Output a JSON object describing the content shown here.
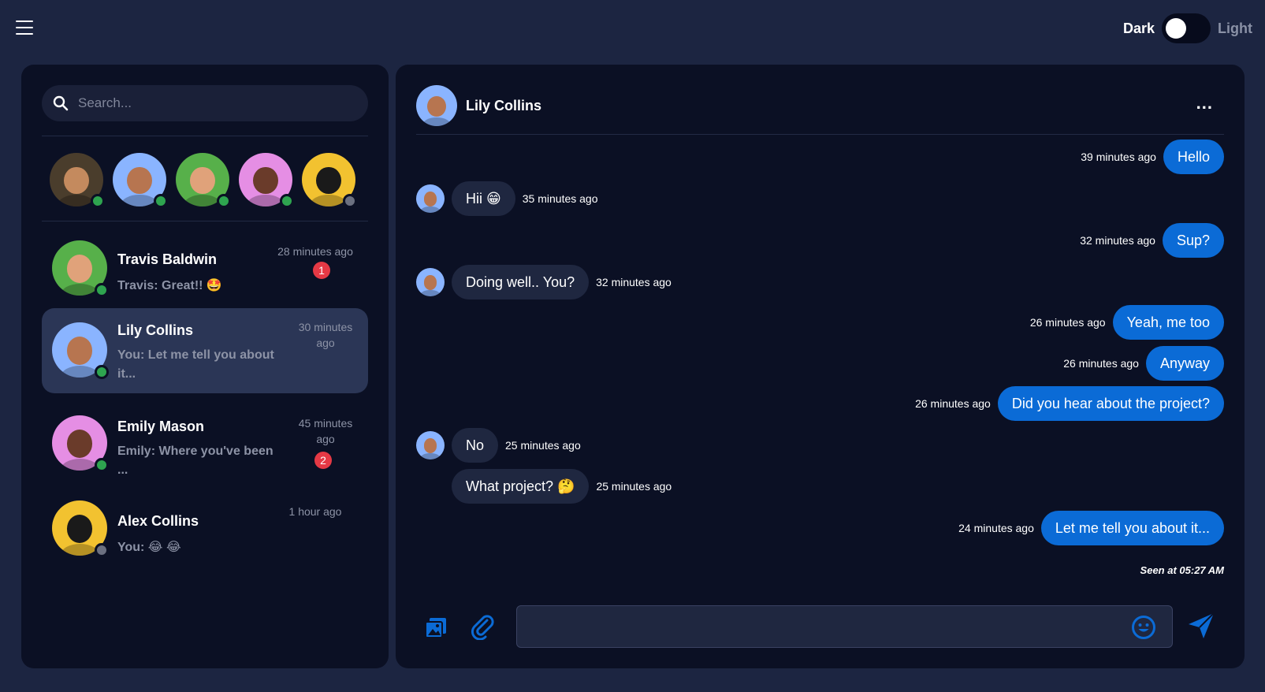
{
  "topbar": {
    "menu_icon": "hamburger-icon",
    "theme_dark_label": "Dark",
    "theme_light_label": "Light"
  },
  "sidebar": {
    "search_placeholder": "Search...",
    "stories": [
      {
        "avatar": "man-hat-avatar",
        "status": "online",
        "bg": "#4a3d2c",
        "skin": "#c48a5e"
      },
      {
        "avatar": "astronaut-woman-avatar",
        "status": "online",
        "bg": "#8ab4ff",
        "skin": "#b77550"
      },
      {
        "avatar": "leprechaun-avatar",
        "status": "online",
        "bg": "#57b04a",
        "skin": "#e0a27a"
      },
      {
        "avatar": "astronaut-dark-avatar",
        "status": "online",
        "bg": "#e58ee4",
        "skin": "#6a3b2a"
      },
      {
        "avatar": "gold-astronaut-avatar",
        "status": "offline",
        "bg": "#f2c230",
        "skin": "#1a1a1a"
      }
    ],
    "conversations": [
      {
        "name": "Travis Baldwin",
        "preview": "Travis: Great!! 🤩",
        "time": "28 minutes ago",
        "badge": "1",
        "active": false
      },
      {
        "name": "Lily Collins",
        "preview": "You: Let me tell you about it...",
        "time": "30 minutes ago",
        "badge": "",
        "active": true
      },
      {
        "name": "Emily Mason",
        "preview": "Emily: Where you've been ...",
        "time": "45 minutes ago",
        "badge": "2",
        "active": false
      },
      {
        "name": "Alex Collins",
        "preview": "You: 😂 😂",
        "time": "1 hour ago",
        "badge": "",
        "active": false
      }
    ]
  },
  "chat": {
    "contact_name": "Lily Collins",
    "more_label": "...",
    "messages": [
      {
        "dir": "out",
        "text": "Hello",
        "time": "39 minutes ago"
      },
      {
        "dir": "in",
        "text": "Hii 😁",
        "time": "35 minutes ago"
      },
      {
        "dir": "out",
        "text": "Sup?",
        "time": "32 minutes ago"
      },
      {
        "dir": "in",
        "text": "Doing well.. You?",
        "time": "32 minutes ago"
      },
      {
        "dir": "out",
        "text": "Yeah, me too",
        "time": "26 minutes ago"
      },
      {
        "dir": "out",
        "text": "Anyway",
        "time": "26 minutes ago"
      },
      {
        "dir": "out",
        "text": "Did you hear about the project?",
        "time": "26 minutes ago"
      },
      {
        "dir": "in",
        "text": "No",
        "time": "25 minutes ago"
      },
      {
        "dir": "in",
        "text": "What project? 🤔",
        "time": "25 minutes ago"
      },
      {
        "dir": "out",
        "text": "Let me tell you about it...",
        "time": "24 minutes ago"
      }
    ],
    "seen_text": "Seen at 05:27 AM",
    "composer": {
      "image_icon": "image-gallery-icon",
      "attach_icon": "paperclip-icon",
      "emoji_icon": "smiley-icon",
      "send_icon": "send-icon",
      "input_value": ""
    }
  },
  "colors": {
    "page_bg": "#1c2541",
    "panel_bg": "#0b1024",
    "accent": "#0b6bd6",
    "active_item": "#2b3656",
    "badge": "#e53945",
    "online": "#2ea44f"
  }
}
